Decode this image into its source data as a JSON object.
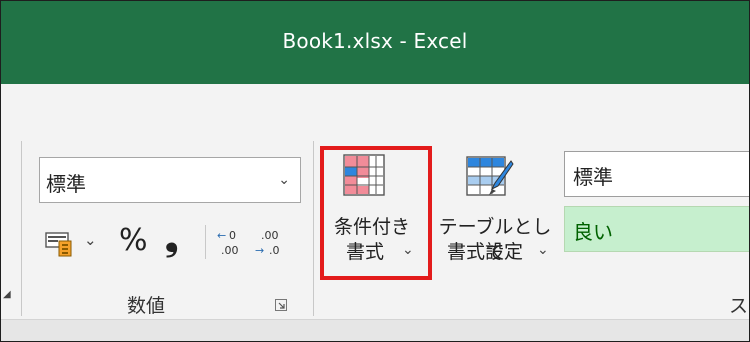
{
  "window": {
    "title": "Book1.xlsx  -  Excel"
  },
  "number_group": {
    "format_value": "標準",
    "label": "数値",
    "percent_symbol": "%",
    "comma_symbol": "❟",
    "accounting_icon": "accounting-format-icon",
    "increase_decimal_icon": "increase-decimal-icon",
    "decrease_decimal_icon": "decrease-decimal-icon"
  },
  "styles_group": {
    "conditional_formatting": {
      "line1": "条件付き",
      "line2": "書式"
    },
    "format_as_table": {
      "line1": "テーブルとして",
      "line2": "書式設定"
    },
    "style_normal": "標準",
    "style_good": "良い",
    "label_partial": "ス"
  },
  "colors": {
    "title_bar": "#217346",
    "highlight": "#e31b1b",
    "good_style_bg": "#c6efce",
    "good_style_text": "#006100"
  }
}
